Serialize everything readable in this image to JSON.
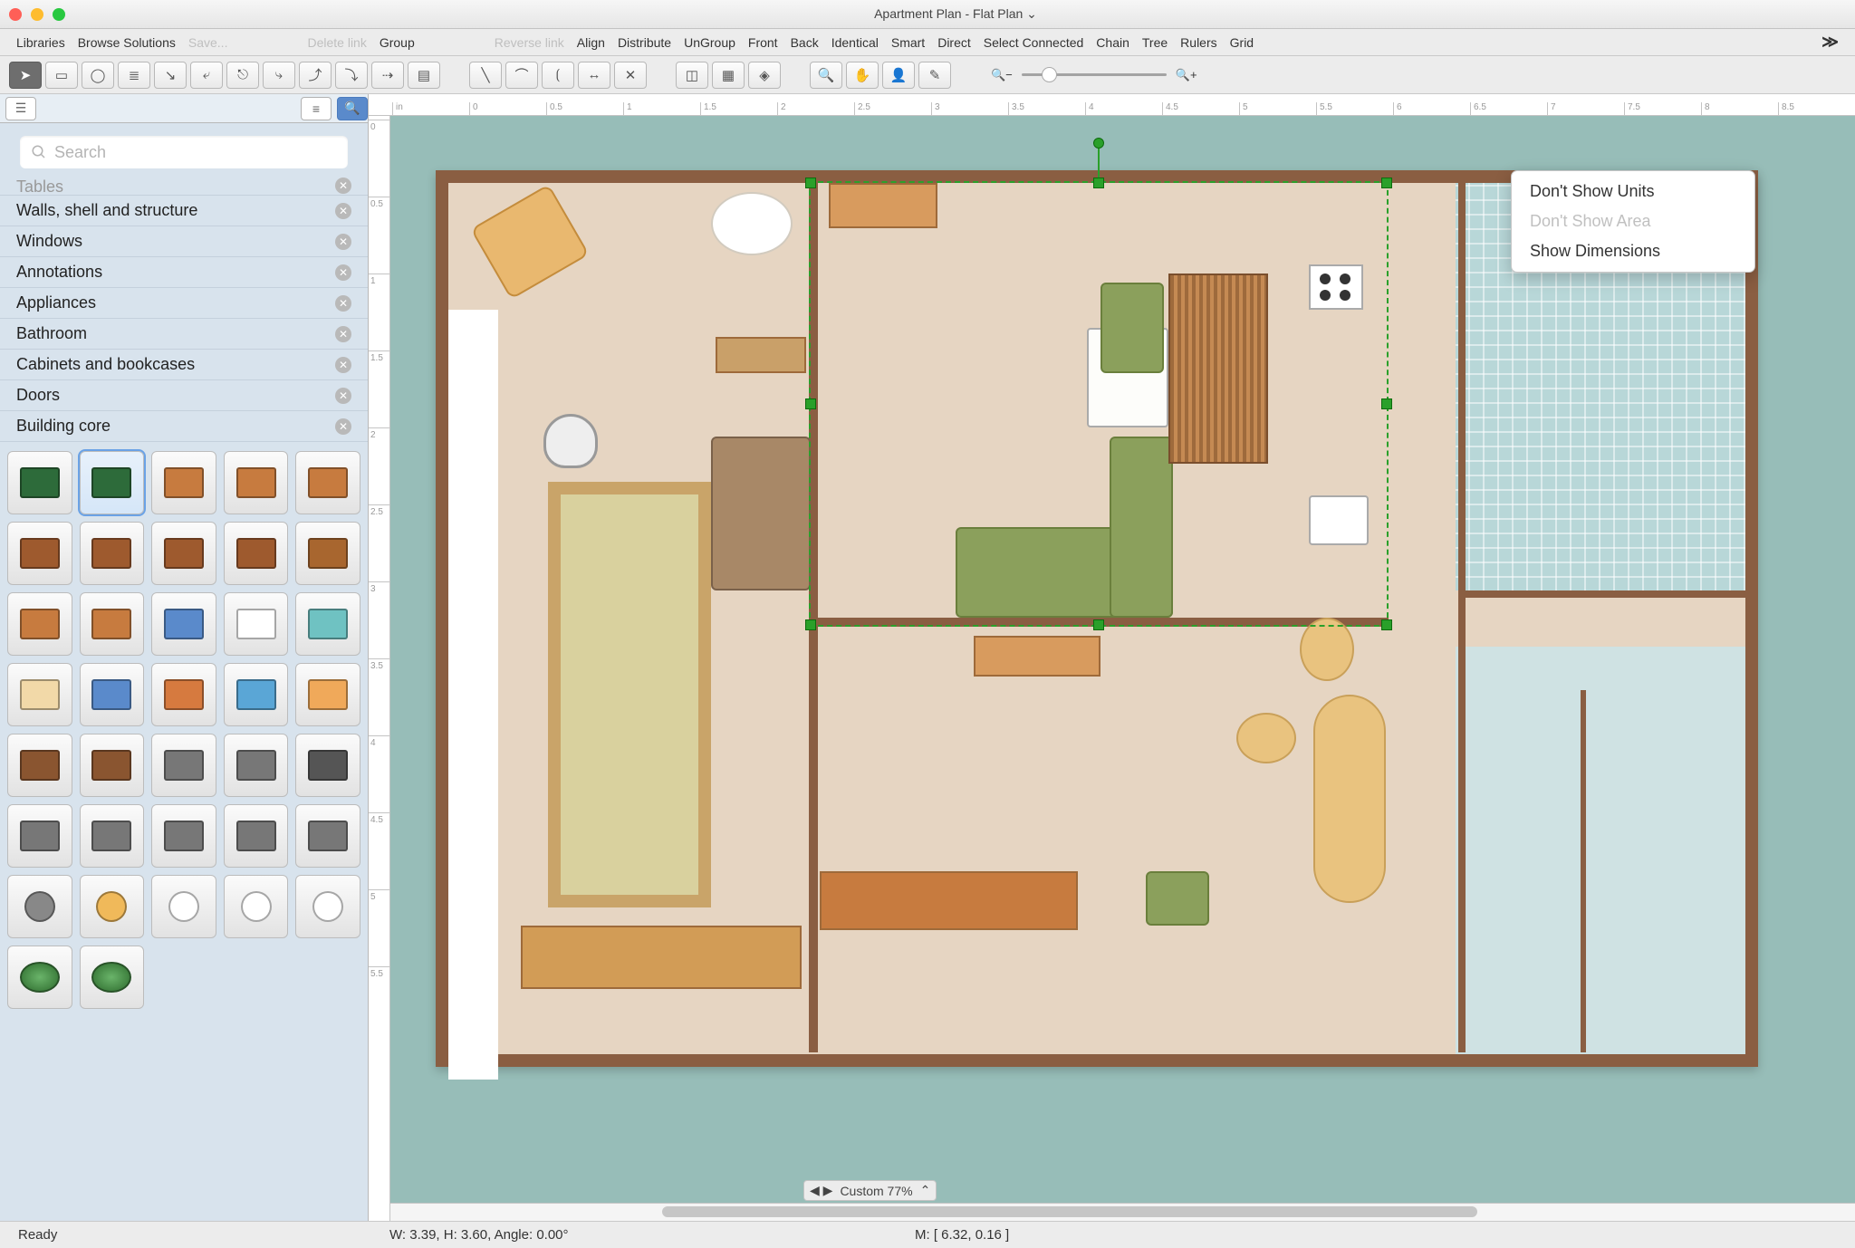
{
  "window": {
    "title": "Apartment Plan - Flat Plan ⌄"
  },
  "menubar": {
    "items": [
      "Libraries",
      "Browse Solutions",
      "Save...",
      "",
      "Delete link",
      "Group",
      "",
      "Reverse link",
      "Align",
      "Distribute",
      "UnGroup",
      "Front",
      "Back",
      "Identical",
      "Smart",
      "Direct",
      "Select Connected",
      "Chain",
      "Tree",
      "Rulers",
      "Grid"
    ],
    "disabled": [
      "Save...",
      "Delete link",
      "Reverse link"
    ]
  },
  "toolbar": {
    "groups": [
      [
        "pointer",
        "rect",
        "ellipse",
        "text",
        "conn1",
        "conn2",
        "conn3",
        "conn4",
        "conn5",
        "conn6",
        "conn7",
        "library"
      ],
      [
        "line1",
        "arc",
        "bracket",
        "dim-h",
        "dim-v"
      ],
      [
        "area1",
        "area2",
        "area3"
      ],
      [
        "zoom",
        "pan",
        "person",
        "eyedrop"
      ]
    ]
  },
  "search": {
    "placeholder": "Search"
  },
  "categories": [
    "Tables",
    "Walls, shell and structure",
    "Windows",
    "Annotations",
    "Appliances",
    "Bathroom",
    "Cabinets and bookcases",
    "Doors",
    "Building core"
  ],
  "ruler_h": [
    "in",
    "0",
    "0.5",
    "1",
    "1.5",
    "2",
    "2.5",
    "3",
    "3.5",
    "4",
    "4.5",
    "5",
    "5.5",
    "6",
    "6.5",
    "7",
    "7.5",
    "8",
    "8.5"
  ],
  "ruler_v": [
    "0",
    "0.5",
    "1",
    "1.5",
    "2",
    "2.5",
    "3",
    "3.5",
    "4",
    "4.5",
    "5",
    "5.5"
  ],
  "context_menu": {
    "items": [
      {
        "label": "Don't Show Units",
        "disabled": false
      },
      {
        "label": "Don't Show Area",
        "disabled": true
      },
      {
        "label": "Show Dimensions",
        "disabled": false
      }
    ]
  },
  "zoom_label": "Custom 77%",
  "status": {
    "ready": "Ready",
    "dims": "W: 3.39,  H: 3.60,  Angle: 0.00°",
    "mouse": "M: [ 6.32, 0.16 ]"
  },
  "shape_palette_count": 37,
  "shape_colors": [
    "#2d6b3a",
    "#2d6b3a",
    "#c77b3f",
    "#c77b3f",
    "#c77b3f",
    "#9e5a2e",
    "#9e5a2e",
    "#9e5a2e",
    "#9e5a2e",
    "#a8662f",
    "#c77b3f",
    "#c77b3f",
    "#5a8acb",
    "#fff",
    "#6fc2c2",
    "#f2d9a8",
    "#5a8acb",
    "#d67a3f",
    "#5aa6d6",
    "#f0a95a",
    "#8a5530",
    "#8a5530",
    "#777",
    "#777",
    "#555",
    "#777",
    "#777",
    "#777",
    "#777",
    "#777",
    "#888",
    "#f0b95a",
    "#fff",
    "#fff",
    "#fff",
    "#3b8a3b",
    "#3b8a3b"
  ]
}
